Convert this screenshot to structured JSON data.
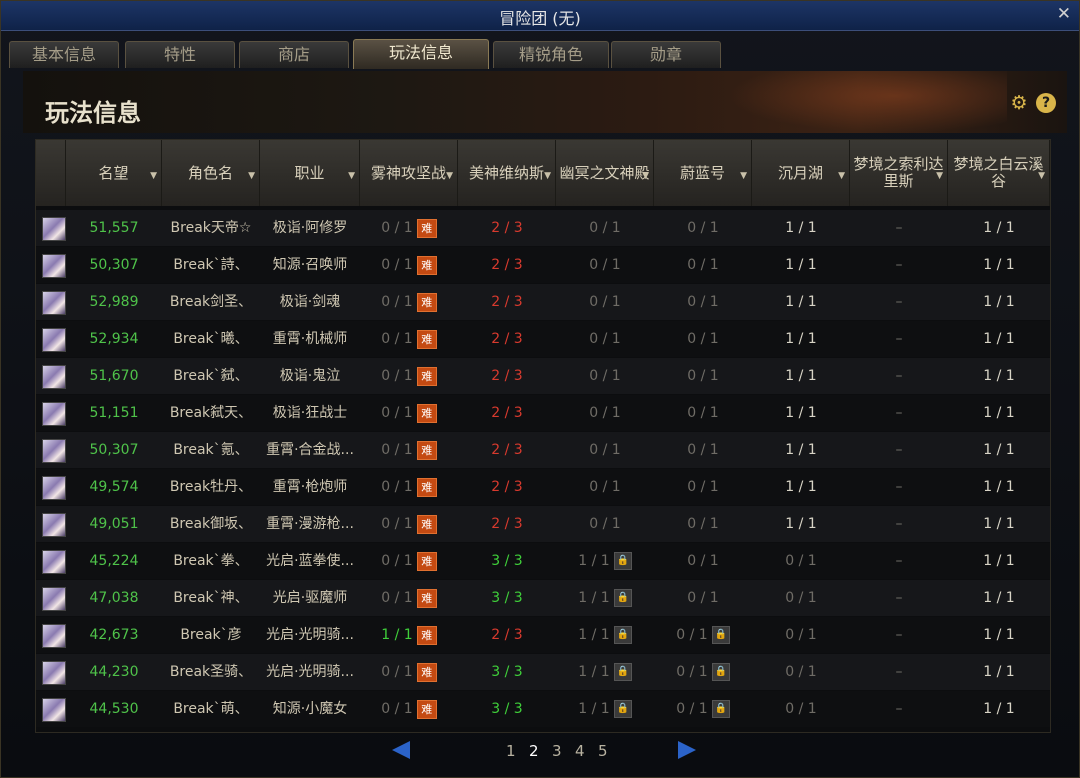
{
  "window": {
    "title": "冒险团 (无)",
    "close_glyph": "✕"
  },
  "tabs": [
    {
      "label": "基本信息",
      "active": false
    },
    {
      "label": "特性",
      "active": false
    },
    {
      "label": "商店",
      "active": false
    },
    {
      "label": "玩法信息",
      "active": true
    },
    {
      "label": "精锐角色",
      "active": false
    },
    {
      "label": "勋章",
      "active": false
    }
  ],
  "page_title": "玩法信息",
  "icons": {
    "gear": "gear-icon",
    "help": "?"
  },
  "columns": [
    {
      "label": ""
    },
    {
      "label": "名望"
    },
    {
      "label": "角色名"
    },
    {
      "label": "职业"
    },
    {
      "label": "雾神攻坚战"
    },
    {
      "label": "美神维纳斯"
    },
    {
      "label": "幽冥之文神殿"
    },
    {
      "label": "蔚蓝号"
    },
    {
      "label": "沉月湖"
    },
    {
      "label": "梦境之索利达里斯"
    },
    {
      "label": "梦境之白云溪谷"
    }
  ],
  "hard_label": "难",
  "lock_label": "🔒",
  "rows": [
    {
      "fame": "51,557",
      "name": "Break天帝☆",
      "job": "极诣·阿修罗",
      "c1": "0 / 1",
      "c2": "2 / 3",
      "c3": "0 / 1",
      "c4": "0 / 1",
      "c5": "1 / 1",
      "c6": "–",
      "c7": "1 / 1"
    },
    {
      "fame": "50,307",
      "name": "Break`詩、",
      "job": "知源·召唤师",
      "c1": "0 / 1",
      "c2": "2 / 3",
      "c3": "0 / 1",
      "c4": "0 / 1",
      "c5": "1 / 1",
      "c6": "–",
      "c7": "1 / 1"
    },
    {
      "fame": "52,989",
      "name": "Break剑圣、",
      "job": "极诣·剑魂",
      "c1": "0 / 1",
      "c2": "2 / 3",
      "c3": "0 / 1",
      "c4": "0 / 1",
      "c5": "1 / 1",
      "c6": "–",
      "c7": "1 / 1"
    },
    {
      "fame": "52,934",
      "name": "Break`曦、",
      "job": "重霄·机械师",
      "c1": "0 / 1",
      "c2": "2 / 3",
      "c3": "0 / 1",
      "c4": "0 / 1",
      "c5": "1 / 1",
      "c6": "–",
      "c7": "1 / 1"
    },
    {
      "fame": "51,670",
      "name": "Break`弑、",
      "job": "极诣·鬼泣",
      "c1": "0 / 1",
      "c2": "2 / 3",
      "c3": "0 / 1",
      "c4": "0 / 1",
      "c5": "1 / 1",
      "c6": "–",
      "c7": "1 / 1"
    },
    {
      "fame": "51,151",
      "name": "Break弑天、",
      "job": "极诣·狂战士",
      "c1": "0 / 1",
      "c2": "2 / 3",
      "c3": "0 / 1",
      "c4": "0 / 1",
      "c5": "1 / 1",
      "c6": "–",
      "c7": "1 / 1"
    },
    {
      "fame": "50,307",
      "name": "Break`氪、",
      "job": "重霄·合金战...",
      "c1": "0 / 1",
      "c2": "2 / 3",
      "c3": "0 / 1",
      "c4": "0 / 1",
      "c5": "1 / 1",
      "c6": "–",
      "c7": "1 / 1"
    },
    {
      "fame": "49,574",
      "name": "Break牡丹、",
      "job": "重霄·枪炮师",
      "c1": "0 / 1",
      "c2": "2 / 3",
      "c3": "0 / 1",
      "c4": "0 / 1",
      "c5": "1 / 1",
      "c6": "–",
      "c7": "1 / 1"
    },
    {
      "fame": "49,051",
      "name": "Break御坂、",
      "job": "重霄·漫游枪...",
      "c1": "0 / 1",
      "c2": "2 / 3",
      "c3": "0 / 1",
      "c4": "0 / 1",
      "c5": "1 / 1",
      "c6": "–",
      "c7": "1 / 1"
    },
    {
      "fame": "45,224",
      "name": "Break`拳、",
      "job": "光启·蓝拳使...",
      "c1": "0 / 1",
      "c2": "3 / 3",
      "c3": "1 / 1",
      "c4": "0 / 1",
      "c5": "0 / 1",
      "c6": "–",
      "c7": "1 / 1"
    },
    {
      "fame": "47,038",
      "name": "Break`神、",
      "job": "光启·驱魔师",
      "c1": "0 / 1",
      "c2": "3 / 3",
      "c3": "1 / 1",
      "c4": "0 / 1",
      "c5": "0 / 1",
      "c6": "–",
      "c7": "1 / 1"
    },
    {
      "fame": "42,673",
      "name": "Break`彦",
      "job": "光启·光明骑...",
      "c1": "1 / 1",
      "c2": "2 / 3",
      "c3": "1 / 1",
      "c4": "0 / 1",
      "c5": "0 / 1",
      "c6": "–",
      "c7": "1 / 1"
    },
    {
      "fame": "44,230",
      "name": "Break圣骑、",
      "job": "光启·光明骑...",
      "c1": "0 / 1",
      "c2": "3 / 3",
      "c3": "1 / 1",
      "c4": "0 / 1",
      "c5": "0 / 1",
      "c6": "–",
      "c7": "1 / 1"
    },
    {
      "fame": "44,530",
      "name": "Break`萌、",
      "job": "知源·小魔女",
      "c1": "0 / 1",
      "c2": "3 / 3",
      "c3": "1 / 1",
      "c4": "0 / 1",
      "c5": "0 / 1",
      "c6": "–",
      "c7": "1 / 1"
    }
  ],
  "pagination": {
    "pages": [
      "1",
      "2",
      "3",
      "4",
      "5"
    ],
    "current": "2"
  },
  "colors": {
    "fame": "#4fc34a",
    "red_count": "#d83a2e",
    "green_count": "#3fcf3a",
    "hard_badge": "#c44a12",
    "arrow": "#2b63c9"
  }
}
